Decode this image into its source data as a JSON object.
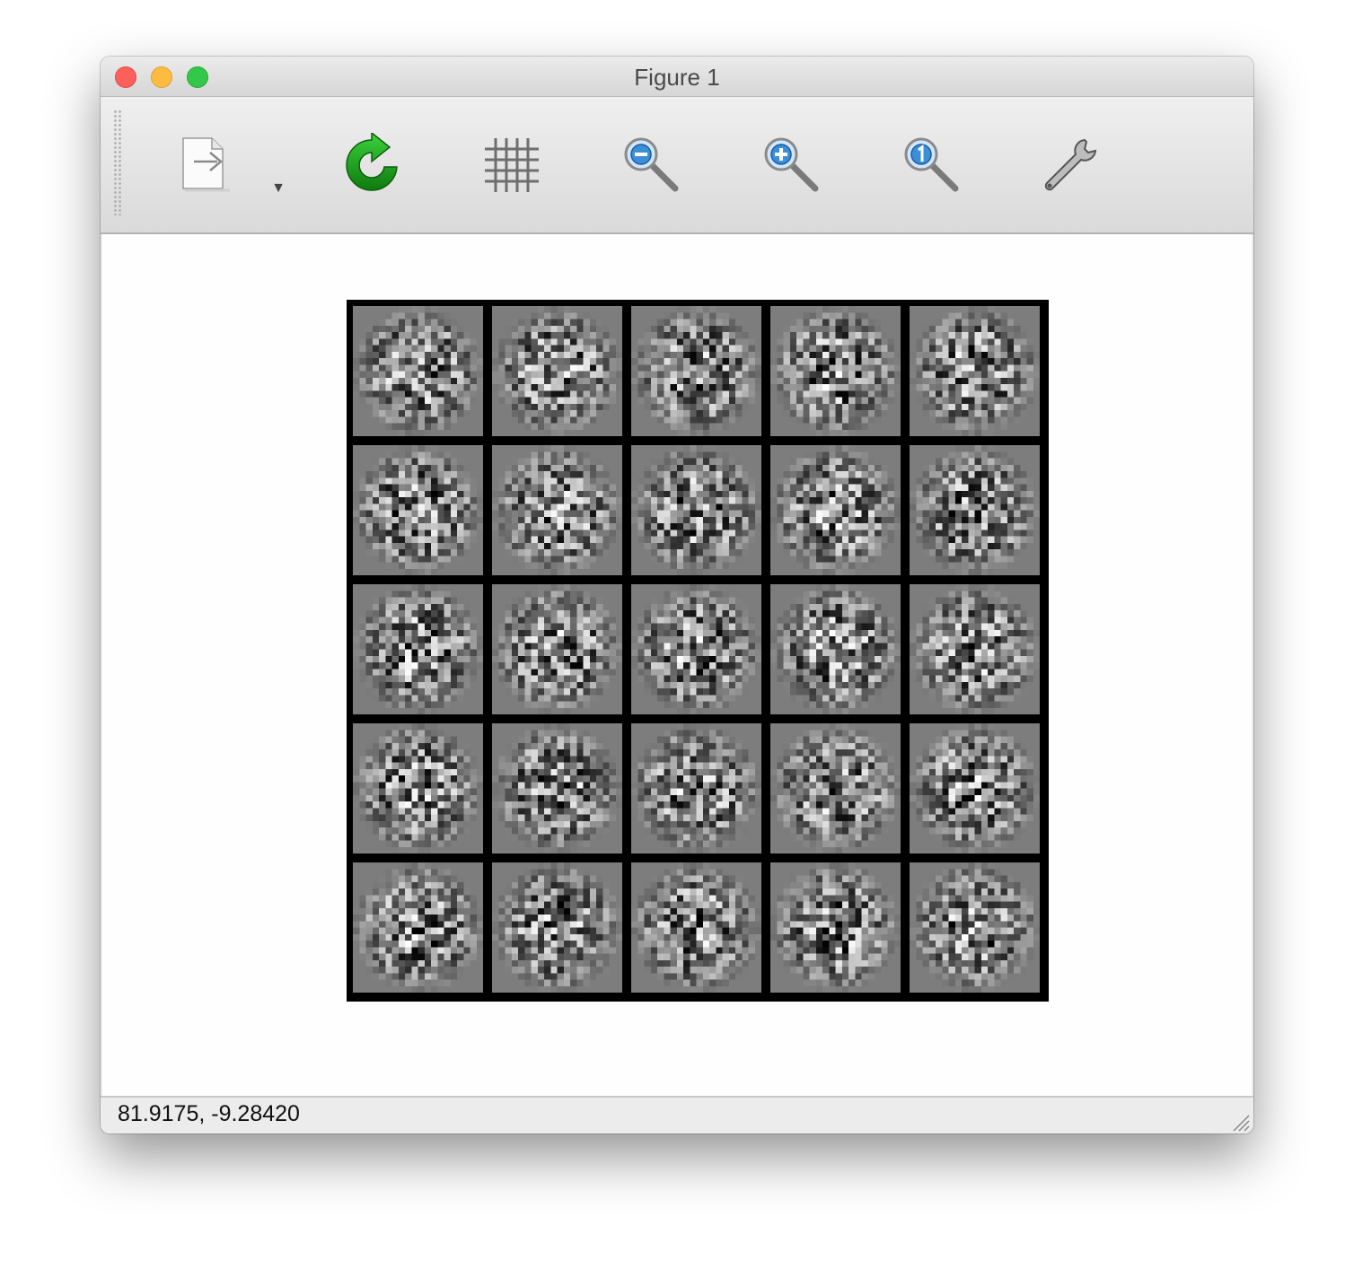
{
  "window": {
    "title": "Figure 1"
  },
  "toolbar": {
    "items": [
      {
        "name": "export-button",
        "icon": "export-document-icon"
      },
      {
        "name": "export-menu-arrow",
        "icon": "triangle-down-icon",
        "glyph": "▼"
      },
      {
        "name": "refresh-button",
        "icon": "green-refresh-arrow-icon"
      },
      {
        "name": "grid-toggle-button",
        "icon": "grid-icon"
      },
      {
        "name": "zoom-out-button",
        "icon": "magnifier-minus-icon"
      },
      {
        "name": "zoom-in-button",
        "icon": "magnifier-plus-icon"
      },
      {
        "name": "zoom-reset-button",
        "icon": "magnifier-one-icon"
      },
      {
        "name": "settings-button",
        "icon": "wrench-icon"
      }
    ]
  },
  "figure": {
    "grid_rows": 5,
    "grid_cols": 5,
    "colormap": "grayscale",
    "tiles": 25
  },
  "status": {
    "coordinates": "81.9175, -9.28420"
  },
  "colors": {
    "close": "#fc605c",
    "minimize": "#fdbc40",
    "maximize": "#34c84a",
    "refresh_green": "#1f9c1f",
    "magnifier_blue": "#3b8fd8"
  }
}
